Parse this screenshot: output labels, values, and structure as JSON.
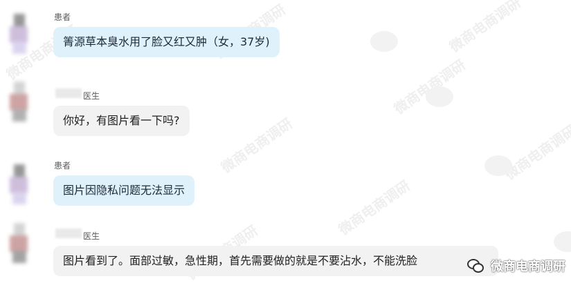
{
  "messages": [
    {
      "role": "patient",
      "name": "患者",
      "text": "箐源草本臭水用了脸又红又肿（女，37岁)"
    },
    {
      "role": "doctor",
      "name": "医生",
      "text": "你好，有图片看一下吗?"
    },
    {
      "role": "patient",
      "name": "患者",
      "text": "图片因隐私问题无法显示"
    },
    {
      "role": "doctor",
      "name": "医生",
      "text": "图片看到了。面部过敏，急性期，首先需要做的就是不要沾水，不能洗脸"
    }
  ],
  "watermark": {
    "text": "微商电商调研",
    "icon": "wechat-icon"
  },
  "colors": {
    "patient_bubble": "#dff1fb",
    "doctor_bubble": "#f2f2f2"
  }
}
